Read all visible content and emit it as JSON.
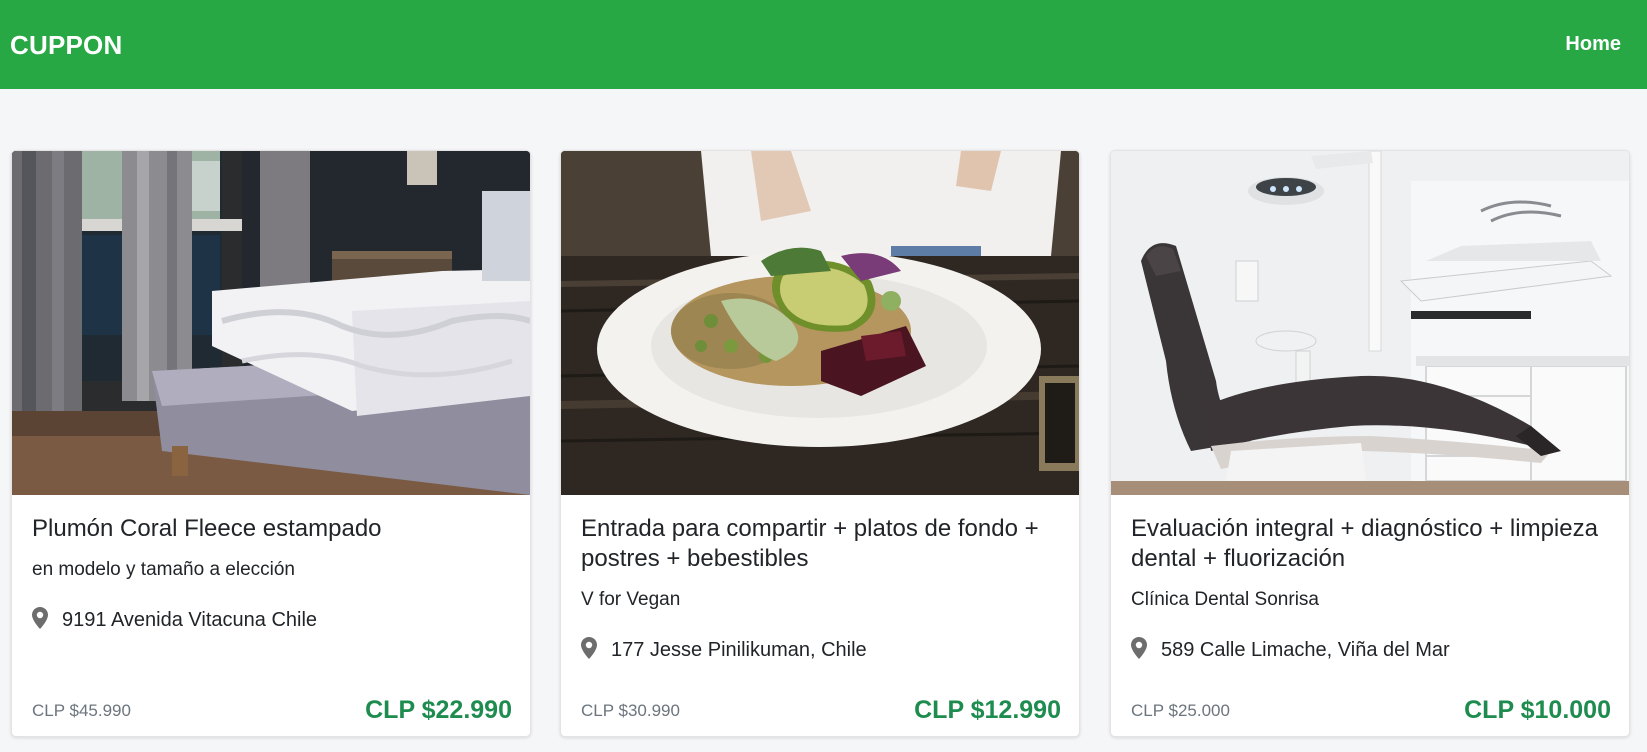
{
  "navbar": {
    "brand": "CUPPON",
    "home_label": "Home",
    "color": "#28a745"
  },
  "deals": [
    {
      "title": "Plumón Coral Fleece estampado",
      "subtitle": "en modelo y tamaño a elección",
      "address": "9191 Avenida Vitacuna Chile",
      "old_price": "CLP $45.990",
      "price": "CLP $22.990",
      "image": "bedroom-bed-photo"
    },
    {
      "title": "Entrada para compartir + platos de fondo + postres + bebestibles",
      "subtitle": "V for Vegan",
      "address": "177 Jesse Pinilikuman, Chile",
      "old_price": "CLP $30.990",
      "price": "CLP $12.990",
      "image": "vegan-plate-photo"
    },
    {
      "title": "Evaluación integral + diagnóstico + limpieza dental + fluorización",
      "subtitle": "Clínica Dental Sonrisa",
      "address": "589 Calle Limache, Viña del Mar",
      "old_price": "CLP $25.000",
      "price": "CLP $10.000",
      "image": "dental-chair-photo"
    }
  ],
  "colors": {
    "price": "#1e8c4e",
    "old_price": "#6c757d",
    "background": "#f5f6f8"
  }
}
